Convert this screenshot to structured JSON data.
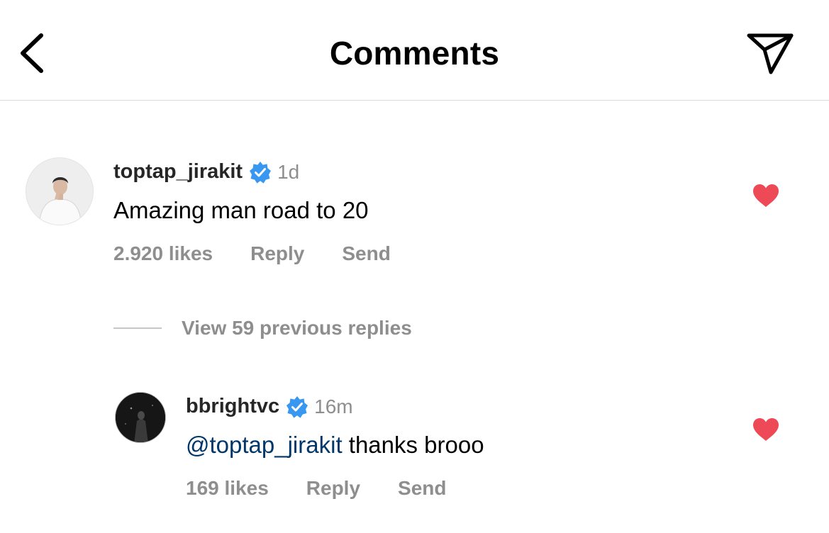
{
  "header": {
    "title": "Comments",
    "back_icon": "chevron-left-icon",
    "share_icon": "paper-plane-icon"
  },
  "colors": {
    "heart": "#ed4956",
    "verified": "#3897f0",
    "mention": "#00376b",
    "muted": "#8e8e8e"
  },
  "comments": [
    {
      "username": "toptap_jirakit",
      "verified": true,
      "time": "1d",
      "text": "Amazing man road to 20",
      "likes": "2.920 likes",
      "reply_label": "Reply",
      "send_label": "Send",
      "liked": true
    }
  ],
  "view_replies": "View 59 previous replies",
  "replies": [
    {
      "username": "bbrightvc",
      "verified": true,
      "time": "16m",
      "mention": "@toptap_jirakit",
      "text": " thanks brooo",
      "likes": "169 likes",
      "reply_label": "Reply",
      "send_label": "Send",
      "liked": true
    }
  ]
}
